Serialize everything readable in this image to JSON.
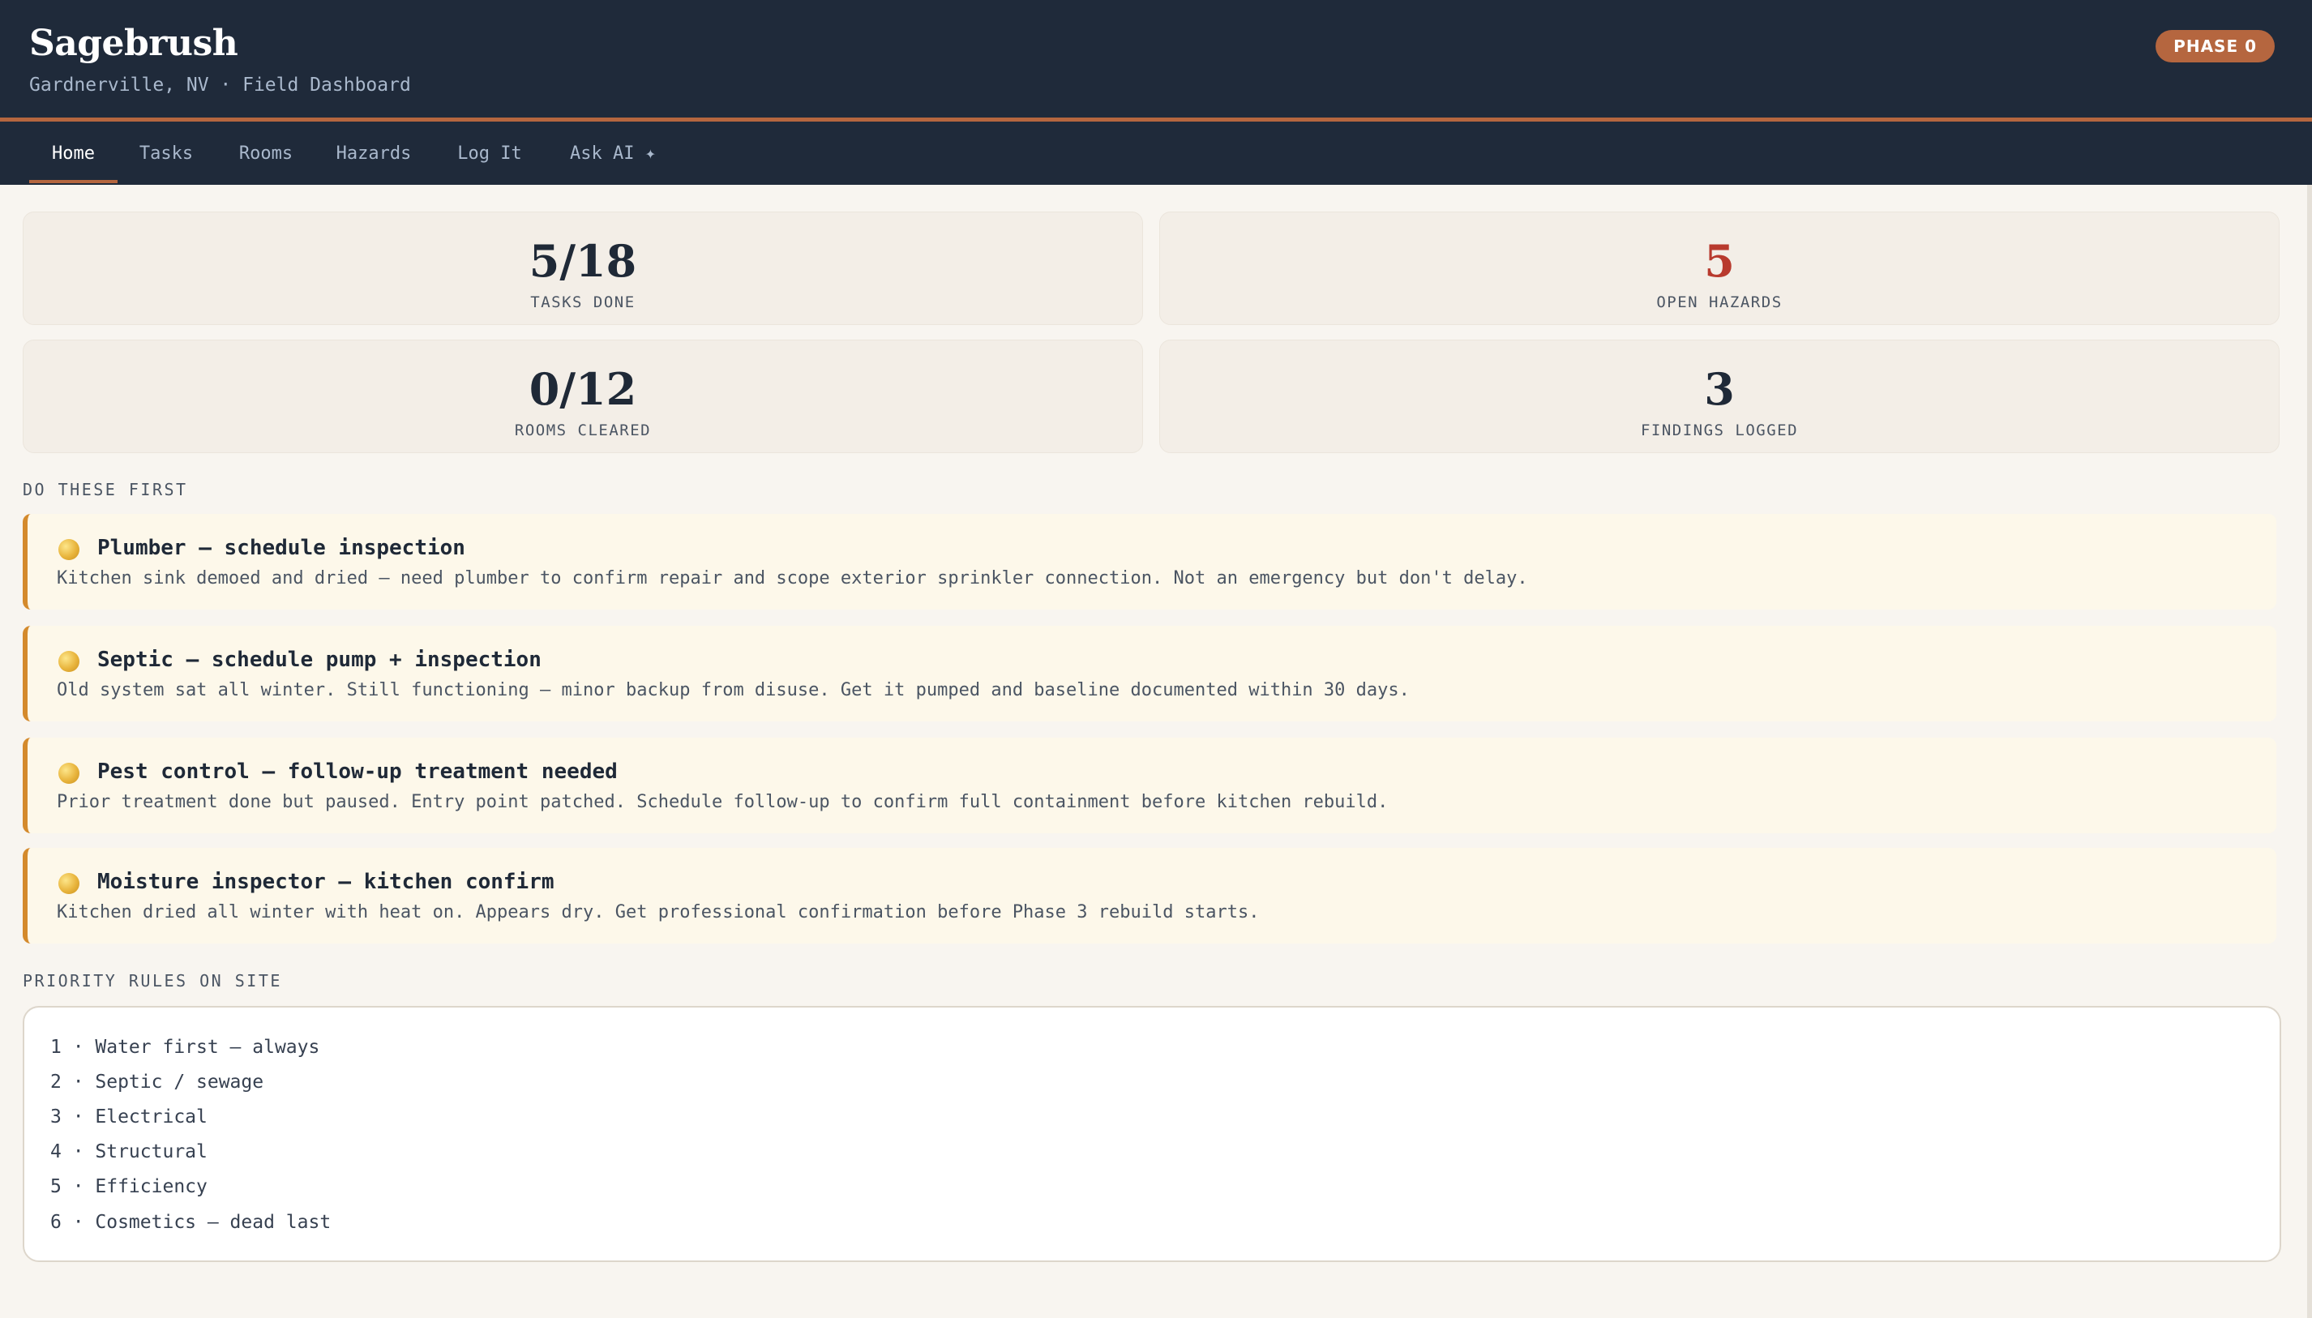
{
  "app": {
    "title": "Sagebrush",
    "subtitle": "Gardnerville, NV · Field Dashboard",
    "phase_badge": "PHASE 0"
  },
  "nav": {
    "tabs": [
      {
        "label": "Home",
        "active": true
      },
      {
        "label": "Tasks",
        "active": false
      },
      {
        "label": "Rooms",
        "active": false
      },
      {
        "label": "Hazards",
        "active": false
      },
      {
        "label": "Log It",
        "active": false
      },
      {
        "label": "Ask AI ✦",
        "active": false
      }
    ]
  },
  "stats": [
    {
      "value": "5/18",
      "label": "TASKS DONE"
    },
    {
      "value": "5",
      "label": "OPEN HAZARDS",
      "color": "#b83a2e"
    },
    {
      "value": "0/12",
      "label": "ROOMS CLEARED"
    },
    {
      "value": "3",
      "label": "FINDINGS LOGGED"
    }
  ],
  "priority_section": {
    "title": "DO THESE FIRST",
    "items": [
      {
        "icon": "yellow-circle-icon",
        "title": "Plumber — schedule inspection",
        "description": "Kitchen sink demoed and dried — need plumber to confirm repair and scope exterior sprinkler connection. Not an emergency but don't delay."
      },
      {
        "icon": "yellow-circle-icon",
        "title": "Septic — schedule pump + inspection",
        "description": "Old system sat all winter. Still functioning — minor backup from disuse. Get it pumped and baseline documented within 30 days."
      },
      {
        "icon": "yellow-circle-icon",
        "title": "Pest control — follow-up treatment needed",
        "description": "Prior treatment done but paused. Entry point patched. Schedule follow-up to confirm full containment before kitchen rebuild."
      },
      {
        "icon": "yellow-circle-icon",
        "title": "Moisture inspector — kitchen confirm",
        "description": "Kitchen dried all winter with heat on. Appears dry. Get professional confirmation before Phase 3 rebuild starts."
      }
    ]
  },
  "rules_section": {
    "title": "PRIORITY RULES ON SITE",
    "rules": [
      "1 · Water first — always",
      "2 · Septic / sewage",
      "3 · Electrical",
      "4 · Structural",
      "5 · Efficiency",
      "6 · Cosmetics — dead last"
    ]
  },
  "colors": {
    "header_bg": "#1f2a3a",
    "accent": "#b5663f",
    "alert": "#b83a2e",
    "task_border": "#d48a2c",
    "task_bg": "#fdf8ea"
  }
}
